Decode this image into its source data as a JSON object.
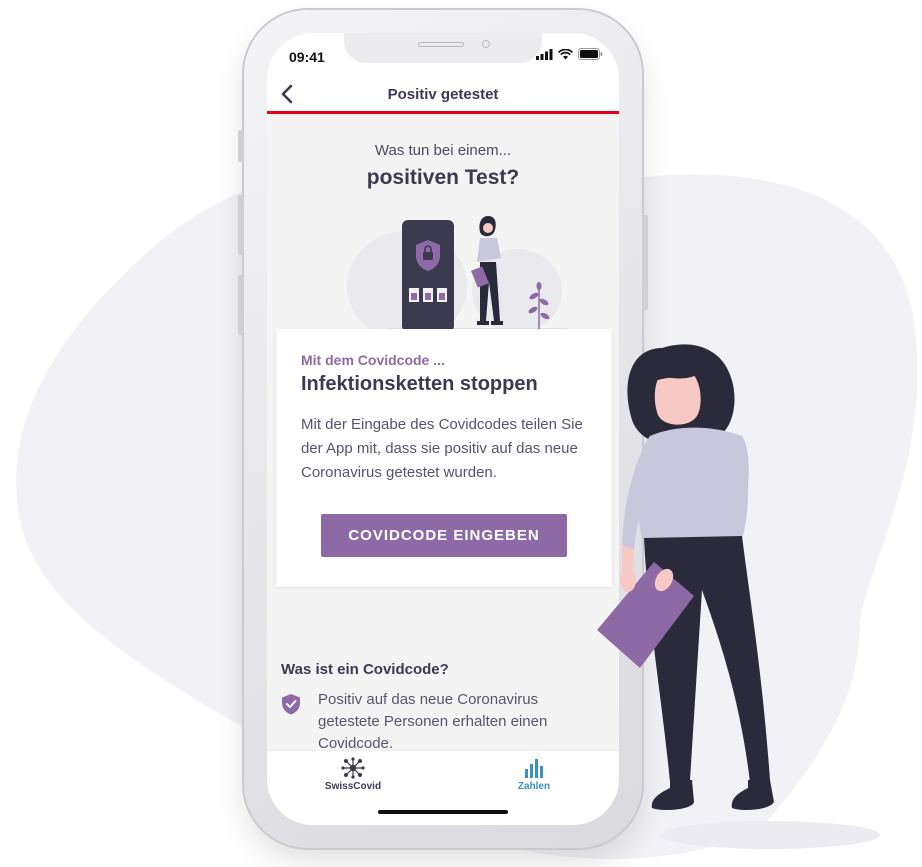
{
  "status_bar": {
    "time": "09:41"
  },
  "nav": {
    "title": "Positiv getestet"
  },
  "intro": {
    "line1": "Was tun bei einem...",
    "line2": "positiven Test?"
  },
  "card": {
    "subtitle": "Mit dem Covidcode ...",
    "title": "Infektionsketten stoppen",
    "body": "Mit der Eingabe des Covidcodes teilen Sie der App mit, dass sie positiv auf das neue Coronavirus getestet wurden.",
    "button_label": "COVIDCODE EINGEBEN"
  },
  "faq": {
    "title": "Was ist ein Covidcode?",
    "items": [
      {
        "text": "Positiv auf das neue Coronavirus getestete Personen erhalten einen Covidcode."
      }
    ]
  },
  "tabs": [
    {
      "label": "SwissCovid",
      "icon": "swisscovid-icon",
      "color": "#3b3a4f"
    },
    {
      "label": "Zahlen",
      "icon": "bar-chart-icon",
      "color": "#3a8fc5"
    }
  ],
  "colors": {
    "accent": "#8d6aa5",
    "red_line": "#e3001b",
    "text_dark": "#3b3a4f"
  }
}
